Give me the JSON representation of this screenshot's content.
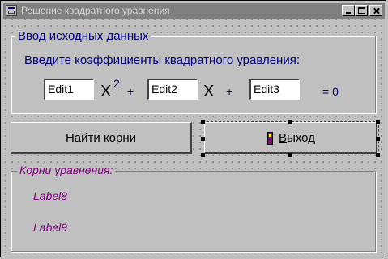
{
  "window": {
    "title": "Решение квадратного уравнения"
  },
  "input_group": {
    "caption": "Ввод исходных данных",
    "prompt": "Введите коэффициенты квадратного уравления:",
    "edit1": "Edit1",
    "edit2": "Edit2",
    "edit3": "Edit3",
    "x_symbol": "X",
    "square": "2",
    "plus": "+",
    "equals_zero": "= 0"
  },
  "buttons": {
    "find_roots": "Найти корни",
    "exit": "Выход"
  },
  "result_group": {
    "caption": "Корни уравнения:",
    "label8": "Label8",
    "label9": "Label9"
  },
  "colors": {
    "form_background": "#c0c0c0",
    "inactive_titlebar": "#808080",
    "navy_text": "#000080",
    "purple_text": "#800080"
  },
  "icons": {
    "title": "form-icon",
    "exit": "door-exit-icon"
  }
}
